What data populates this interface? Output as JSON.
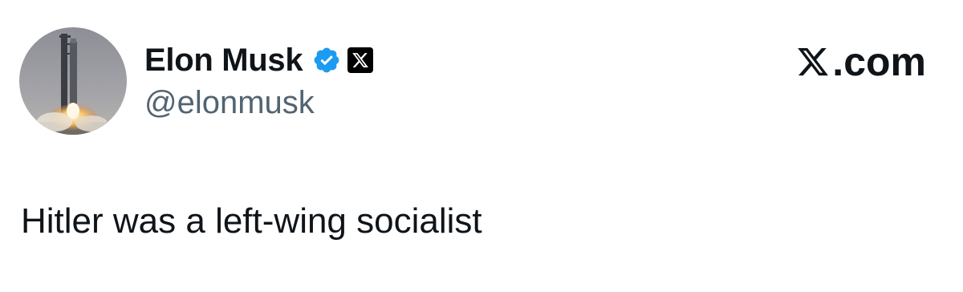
{
  "tweet": {
    "author": {
      "display_name": "Elon Musk",
      "handle": "@elonmusk",
      "avatar_icon": "rocket-launch-avatar",
      "verified_icon": "verified-badge-icon",
      "affiliate_icon": "x-affiliate-badge-icon"
    },
    "text": "Hitler was a left-wing socialist"
  },
  "branding": {
    "site_logo_icon": "x-logo-icon",
    "site_suffix": ".com"
  },
  "colors": {
    "text_primary": "#0f1419",
    "text_secondary": "#536471",
    "verified_blue": "#1d9bf0",
    "background": "#ffffff"
  }
}
